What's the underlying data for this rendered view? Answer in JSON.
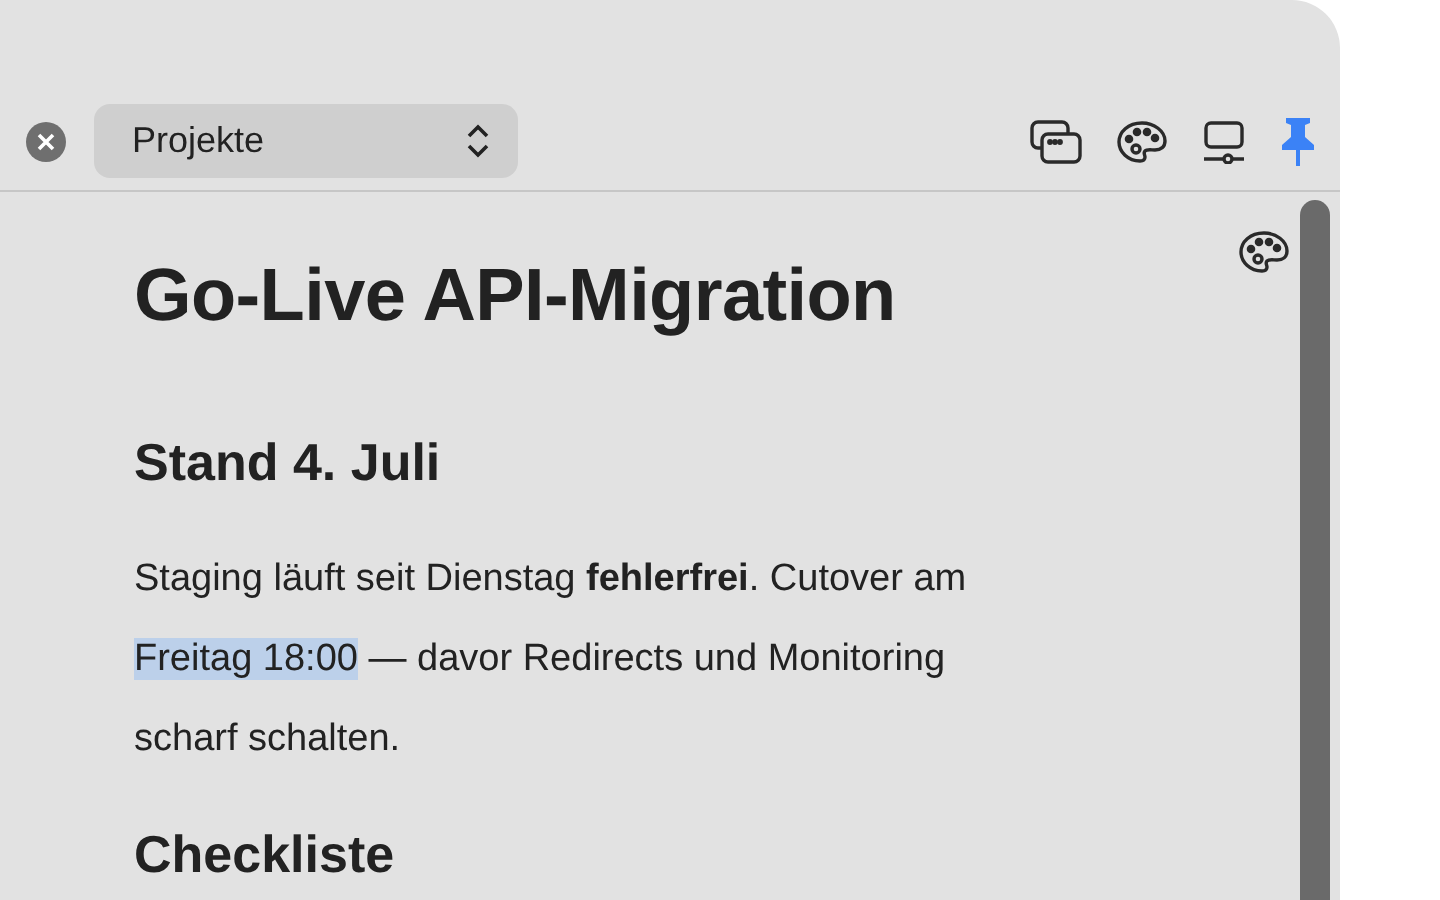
{
  "toolbar": {
    "dropdown": {
      "value": "Projekte"
    },
    "pin": {
      "on": true
    }
  },
  "document": {
    "title": "Go-Live API-Migration",
    "sections": [
      {
        "heading": "Stand 4. Juli",
        "paragraphs": [
          [
            {
              "text": "Staging läuft seit Dienstag **fehlerfrei**. Cutover am ",
              "selected": false
            },
            {
              "text": "Freitag 18:00",
              "selected": true
            },
            {
              "text": " — davor Redirects und Monitoring scharf schalten.",
              "selected": false
            }
          ]
        ]
      },
      {
        "heading": "Checkliste"
      }
    ]
  }
}
